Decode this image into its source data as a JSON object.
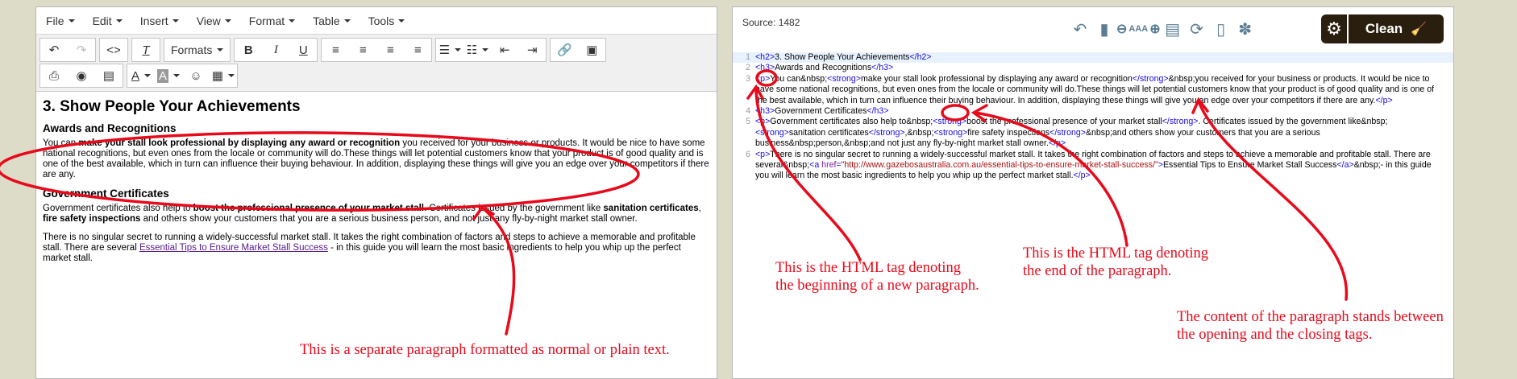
{
  "editor": {
    "menu": [
      "File",
      "Edit",
      "Insert",
      "View",
      "Format",
      "Table",
      "Tools"
    ],
    "formats_label": "Formats",
    "heading": "3. Show People Your Achievements",
    "sub1": "Awards and Recognitions",
    "p1_a": "You can ",
    "p1_b": "make your stall look professional by displaying any award or recognition",
    "p1_c": " you received for your business or products. It would be nice to have some national recognitions, but even ones from the locale or community will do.These things will let potential customers know that your product is of good quality and is one of the best available, which in turn can influence their buying behaviour. In addition, displaying these things will give you an edge over your competitors if there are any.",
    "sub2": "Government Certificates",
    "p2_a": "Government certificates also help to ",
    "p2_b": "boost the professional presence of your market stall",
    "p2_c": ". Certificates issued by the government like ",
    "p2_d": "sanitation certificates",
    "p2_e": ", ",
    "p2_f": "fire safety inspections",
    "p2_g": " and others show your customers that you are a serious business person, and not just any fly-by-night market stall owner.",
    "p3_a": "There is no singular secret to running a widely-successful market stall. It takes the right combination of factors and steps to achieve a memorable and profitable stall. There are several ",
    "p3_link": "Essential Tips to Ensure Market Stall Success",
    "p3_b": " - in this guide you will learn the most basic ingredients to help you whip up the perfect market stall."
  },
  "source": {
    "title": "Source: 1482",
    "zoom_label": "AAA",
    "clean_label": "Clean",
    "lines": {
      "n1": "1",
      "n2": "2",
      "n3": "3",
      "n4": "4",
      "n5": "5",
      "n6": "6",
      "l1_text": "3. Show People Your Achievements",
      "l2_text": "Awards and Recognitions",
      "l3_a": "You can&nbsp;",
      "l3_b": "make your stall look professional by displaying any award or recognition",
      "l3_c": "&nbsp;you received for your business or products. It would be nice to have some national recognitions, but even ones from the locale or community will do.These things will let potential customers know that your product is of good quality and is one of the best available, which in turn can influence their buying behaviour. In addition, displaying these things will give you an edge over your competitors if there are any.",
      "l4_text": "Government Certificates",
      "l5_a": "Government certificates also help to&nbsp;",
      "l5_b": "boost the professional presence of your market stall",
      "l5_c": ". Certificates issued by the government like&nbsp;",
      "l5_d": "sanitation certificates",
      "l5_e": ",&nbsp;",
      "l5_f": "fire safety inspections",
      "l5_g": "&nbsp;and others show your customers that you are a serious business&nbsp;person,&nbsp;and not just any fly-by-night market stall owner.",
      "l6_a": "There is no singular secret to running a widely-successful market stall. It takes the right combination of factors and steps to achieve a memorable and profitable stall. There are several&nbsp;",
      "l6_href": "\"http://www.gazebosaustralia.com.au/essential-tips-to-ensure-market-stall-success/\"",
      "l6_link": "Essential Tips to Ensure Market Stall Success",
      "l6_b": "&nbsp;- in this guide you will learn the most basic ingredients to help you whip up the perfect market stall."
    }
  },
  "annotations": {
    "a1": "This is a separate paragraph formatted as normal or plain text.",
    "a2_l1": "This is the HTML tag denoting",
    "a2_l2": "the beginning of a new paragraph.",
    "a3_l1": "This is the HTML tag denoting",
    "a3_l2": "the end of the paragraph.",
    "a4_l1": "The content of the paragraph stands between",
    "a4_l2": "the opening and the closing tags."
  },
  "colors": {
    "annotation": "#e8091a",
    "clean_button": "#2a1f0e",
    "tag": "#170ce0"
  }
}
